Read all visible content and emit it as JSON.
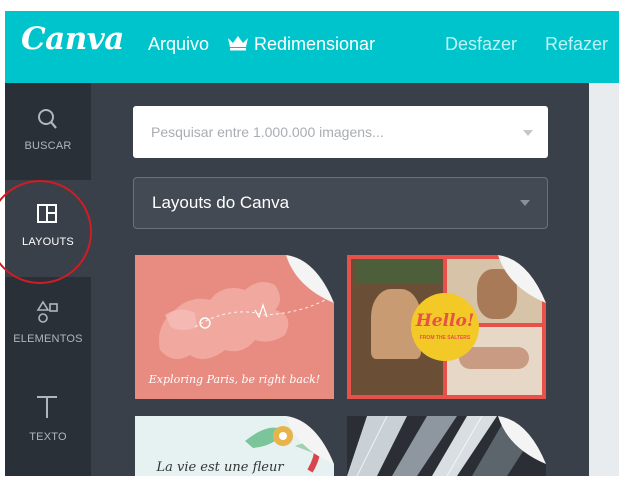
{
  "app": {
    "logo": "Canva",
    "menu": {
      "arquivo": "Arquivo",
      "redimensionar": "Redimensionar",
      "desfazer": "Desfazer",
      "refazer": "Refazer"
    }
  },
  "sidebar": {
    "items": [
      {
        "label": "BUSCAR",
        "icon": "search-icon"
      },
      {
        "label": "LAYOUTS",
        "icon": "layouts-icon",
        "active": true
      },
      {
        "label": "ELEMENTOS",
        "icon": "elements-icon"
      },
      {
        "label": "TEXTO",
        "icon": "text-icon"
      }
    ]
  },
  "panel": {
    "search_placeholder": "Pesquisar entre 1.000.000 imagens...",
    "category_select": "Layouts do Canva",
    "layouts": [
      {
        "caption": "Exploring Paris, be right back!"
      },
      {
        "badge": "Hello!",
        "badge_sub": "FROM THE SALTERS"
      },
      {
        "caption": "La vie est une fleur"
      },
      {}
    ]
  },
  "colors": {
    "brand": "#00c4cc",
    "sidebar_bg": "#1e2329",
    "panel_bg": "#3a4049",
    "annotation": "#d01c23"
  }
}
